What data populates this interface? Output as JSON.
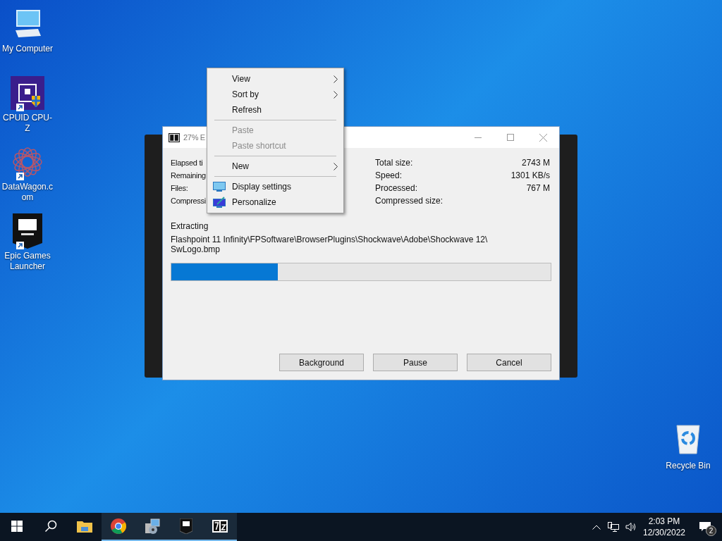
{
  "desktop_icons": [
    {
      "label": "My Computer",
      "kind": "computer",
      "shortcut": false
    },
    {
      "label": "CPUID CPU-Z",
      "kind": "cpuz",
      "shortcut": true
    },
    {
      "label": "DataWagon.c om",
      "kind": "datawagon",
      "shortcut": true
    },
    {
      "label": "Epic Games Launcher",
      "kind": "epic",
      "shortcut": true
    }
  ],
  "recycle_bin": {
    "label": "Recycle Bin"
  },
  "window": {
    "title": "27% E",
    "stats_left": [
      {
        "label": "Elapsed ti"
      },
      {
        "label": "Remaining"
      },
      {
        "label": "Files:"
      },
      {
        "label": "Compressi"
      }
    ],
    "stats_right": [
      {
        "label": "Total size:",
        "value": "2743 M"
      },
      {
        "label": "Speed:",
        "value": "1301 KB/s"
      },
      {
        "label": "Processed:",
        "value": "767 M"
      },
      {
        "label": "Compressed size:"
      }
    ],
    "status": "Extracting",
    "path_lines": [
      "Flashpoint 11 Infinity\\FPSoftware\\BrowserPlugins\\Shockwave\\Adobe\\Shockwave 12\\",
      "SwLogo.bmp"
    ],
    "progress": {
      "level": 0.28
    },
    "buttons": [
      "Background",
      "Pause",
      "Cancel"
    ]
  },
  "context_menu": [
    {
      "kind": "item",
      "label": "View",
      "submenu": true,
      "disabled": false
    },
    {
      "kind": "item",
      "label": "Sort by",
      "submenu": true,
      "disabled": false
    },
    {
      "kind": "item",
      "label": "Refresh",
      "submenu": false,
      "disabled": false
    },
    {
      "kind": "separator"
    },
    {
      "kind": "item",
      "label": "Paste",
      "submenu": false,
      "disabled": true
    },
    {
      "kind": "item",
      "label": "Paste shortcut",
      "submenu": false,
      "disabled": true
    },
    {
      "kind": "separator"
    },
    {
      "kind": "item",
      "label": "New",
      "submenu": true,
      "disabled": false
    },
    {
      "kind": "separator"
    },
    {
      "kind": "display",
      "label": "Display settings",
      "submenu": false,
      "disabled": false
    },
    {
      "kind": "personalize",
      "label": "Personalize",
      "submenu": false,
      "disabled": false
    }
  ],
  "taskbar": {
    "apps": [
      {
        "kind": "start",
        "running": false
      },
      {
        "kind": "search",
        "running": false
      },
      {
        "kind": "explorer",
        "running": false
      },
      {
        "kind": "chrome",
        "running": true
      },
      {
        "kind": "installer",
        "running": true
      },
      {
        "kind": "epic",
        "running": true
      },
      {
        "kind": "sevenzip",
        "running": true
      }
    ],
    "time": "2:03 PM",
    "date": "12/30/2022",
    "notifications": "2"
  }
}
